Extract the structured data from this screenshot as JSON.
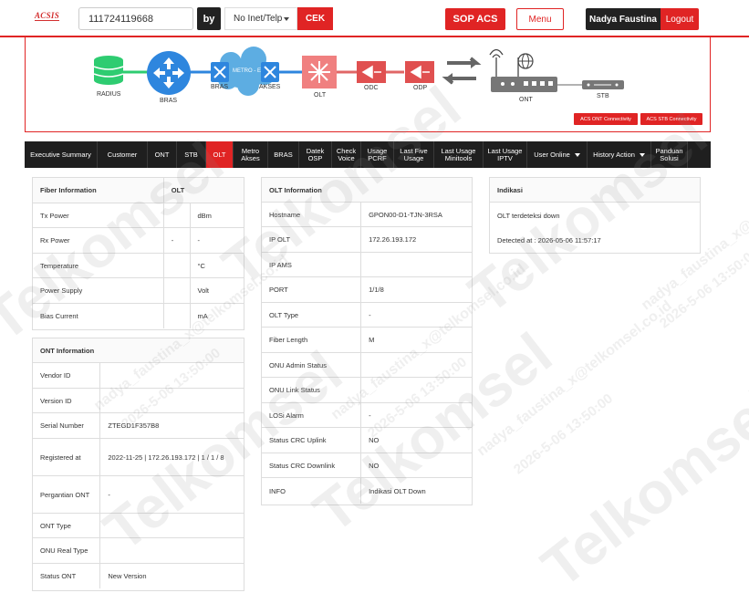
{
  "header": {
    "logo": "ACSIS",
    "search_value": "111724119668",
    "by_label": "by",
    "select_value": "No Inet/Telp",
    "cek_label": "CEK",
    "sop_label": "SOP ACS",
    "menu_label": "Menu",
    "user_name": "Nadya Faustina",
    "logout_label": "Logout"
  },
  "topology": {
    "radius": "RADIUS",
    "bras1": "BRAS",
    "bras2": "BRAS",
    "metro": "METRO - E",
    "akses": "AKSES",
    "olt": "OLT",
    "odc": "ODC",
    "odp": "ODP",
    "ont": "ONT",
    "stb": "STB",
    "acs_ont": "ACS ONT Connectivity",
    "acs_stb": "ACS STB Connectivity"
  },
  "nav": {
    "tabs": [
      "Executive Summary",
      "Customer",
      "ONT",
      "STB",
      "OLT",
      "Metro Akses",
      "BRAS",
      "Datek OSP",
      "Check Voice",
      "Usage PCRF",
      "Last Five Usage",
      "Last Usage Minitools",
      "Last Usage IPTV",
      "User Online",
      "History Action",
      "Panduan Solusi"
    ],
    "active": "OLT"
  },
  "fiber": {
    "header": "Fiber Information",
    "header2": "OLT",
    "rows": [
      [
        "Tx Power",
        "",
        "dBm"
      ],
      [
        "Rx Power",
        "-",
        "-"
      ],
      [
        "Temperature",
        "",
        "°C"
      ],
      [
        "Power Supply",
        "",
        "Volt"
      ],
      [
        "Bias Current",
        "",
        "mA"
      ]
    ]
  },
  "ont": {
    "header": "ONT Information",
    "rows": [
      [
        "Vendor ID",
        ""
      ],
      [
        "Version ID",
        ""
      ],
      [
        "Serial Number",
        "ZTEGD1F357B8"
      ],
      [
        "Registered at",
        "2022-11-25 | 172.26.193.172 | 1 / 1 / 8"
      ],
      [
        "Pergantian ONT",
        "-"
      ],
      [
        "ONT Type",
        ""
      ],
      [
        "ONU Real Type",
        ""
      ],
      [
        "Status ONT",
        "New Version"
      ]
    ]
  },
  "olt": {
    "header": "OLT Information",
    "rows": [
      [
        "Hostname",
        "GPON00-D1-TJN-3RSA"
      ],
      [
        "IP OLT",
        "172.26.193.172"
      ],
      [
        "IP AMS",
        ""
      ],
      [
        "PORT",
        "1/1/8"
      ],
      [
        "OLT Type",
        "-"
      ],
      [
        "Fiber Length",
        "M"
      ],
      [
        "ONU Admin Status",
        ""
      ],
      [
        "ONU Link Status",
        ""
      ],
      [
        "LOSi Alarm",
        "-"
      ],
      [
        "Status CRC Uplink",
        "NO"
      ],
      [
        "Status CRC Downlink",
        "NO"
      ],
      [
        "INFO",
        "Indikasi OLT Down"
      ]
    ]
  },
  "indikasi": {
    "header": "Indikasi",
    "text": "OLT terdeteksi down",
    "detected": "Detected at : 2026-05-06 11:57:17"
  },
  "watermark": {
    "brand": "Telkomsel",
    "email": "nadya_faustina_x@telkomsel.co.id",
    "date": "2026-5-06 13:50:00"
  }
}
